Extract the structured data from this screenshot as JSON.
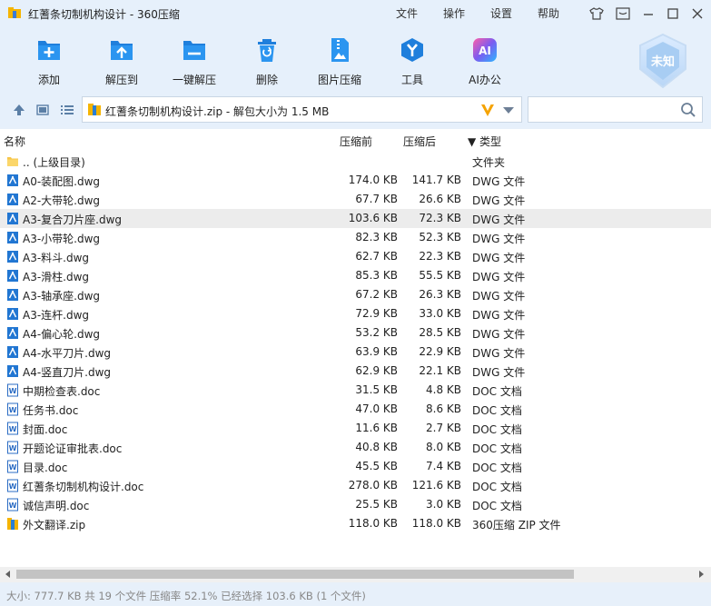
{
  "window": {
    "title": "红蓍条切制机构设计 - 360压缩",
    "menu": [
      "文件",
      "操作",
      "设置",
      "帮助"
    ]
  },
  "toolbar": {
    "items": [
      {
        "label": "添加",
        "icon": "add-file-icon"
      },
      {
        "label": "解压到",
        "icon": "extract-to-icon"
      },
      {
        "label": "一键解压",
        "icon": "one-click-extract-icon"
      },
      {
        "label": "删除",
        "icon": "recycle-delete-icon"
      },
      {
        "label": "图片压缩",
        "icon": "image-compress-icon"
      },
      {
        "label": "工具",
        "icon": "tools-icon"
      },
      {
        "label": "AI办公",
        "icon": "ai-office-icon"
      }
    ],
    "badge": "未知",
    "badge_icon": "security-shield-icon"
  },
  "address": {
    "path": "红蓍条切制机构设计.zip - 解包大小为 1.5 MB",
    "search_placeholder": ""
  },
  "columns": {
    "name": "名称",
    "before": "压缩前",
    "after": "压缩后",
    "type": "▼ 类型"
  },
  "files": [
    {
      "name": ".. (上级目录)",
      "before": "",
      "after": "",
      "type": "文件夹",
      "kind": "folder"
    },
    {
      "name": "A0-装配图.dwg",
      "before": "174.0 KB",
      "after": "141.7 KB",
      "type": "DWG 文件",
      "kind": "dwg"
    },
    {
      "name": "A2-大带轮.dwg",
      "before": "67.7 KB",
      "after": "26.6 KB",
      "type": "DWG 文件",
      "kind": "dwg"
    },
    {
      "name": "A3-复合刀片座.dwg",
      "before": "103.6 KB",
      "after": "72.3 KB",
      "type": "DWG 文件",
      "kind": "dwg",
      "selected": true
    },
    {
      "name": "A3-小带轮.dwg",
      "before": "82.3 KB",
      "after": "52.3 KB",
      "type": "DWG 文件",
      "kind": "dwg"
    },
    {
      "name": "A3-料斗.dwg",
      "before": "62.7 KB",
      "after": "22.3 KB",
      "type": "DWG 文件",
      "kind": "dwg"
    },
    {
      "name": "A3-滑柱.dwg",
      "before": "85.3 KB",
      "after": "55.5 KB",
      "type": "DWG 文件",
      "kind": "dwg"
    },
    {
      "name": "A3-轴承座.dwg",
      "before": "67.2 KB",
      "after": "26.3 KB",
      "type": "DWG 文件",
      "kind": "dwg"
    },
    {
      "name": "A3-连杆.dwg",
      "before": "72.9 KB",
      "after": "33.0 KB",
      "type": "DWG 文件",
      "kind": "dwg"
    },
    {
      "name": "A4-偏心轮.dwg",
      "before": "53.2 KB",
      "after": "28.5 KB",
      "type": "DWG 文件",
      "kind": "dwg"
    },
    {
      "name": "A4-水平刀片.dwg",
      "before": "63.9 KB",
      "after": "22.9 KB",
      "type": "DWG 文件",
      "kind": "dwg"
    },
    {
      "name": "A4-竖直刀片.dwg",
      "before": "62.9 KB",
      "after": "22.1 KB",
      "type": "DWG 文件",
      "kind": "dwg"
    },
    {
      "name": "中期检查表.doc",
      "before": "31.5 KB",
      "after": "4.8 KB",
      "type": "DOC 文档",
      "kind": "doc"
    },
    {
      "name": "任务书.doc",
      "before": "47.0 KB",
      "after": "8.6 KB",
      "type": "DOC 文档",
      "kind": "doc"
    },
    {
      "name": "封面.doc",
      "before": "11.6 KB",
      "after": "2.7 KB",
      "type": "DOC 文档",
      "kind": "doc"
    },
    {
      "name": "开题论证审批表.doc",
      "before": "40.8 KB",
      "after": "8.0 KB",
      "type": "DOC 文档",
      "kind": "doc"
    },
    {
      "name": "目录.doc",
      "before": "45.5 KB",
      "after": "7.4 KB",
      "type": "DOC 文档",
      "kind": "doc"
    },
    {
      "name": "红蓍条切制机构设计.doc",
      "before": "278.0 KB",
      "after": "121.6 KB",
      "type": "DOC 文档",
      "kind": "doc"
    },
    {
      "name": "诚信声明.doc",
      "before": "25.5 KB",
      "after": "3.0 KB",
      "type": "DOC 文档",
      "kind": "doc"
    },
    {
      "name": "外文翻译.zip",
      "before": "118.0 KB",
      "after": "118.0 KB",
      "type": "360压缩 ZIP 文件",
      "kind": "zip"
    }
  ],
  "status": "大小: 777.7 KB 共 19 个文件 压缩率 52.1% 已经选择 103.6 KB (1 个文件)",
  "colors": {
    "accent": "#2a8ae2",
    "chrome": "#e6f0fb",
    "selected_row": "#ececec"
  }
}
